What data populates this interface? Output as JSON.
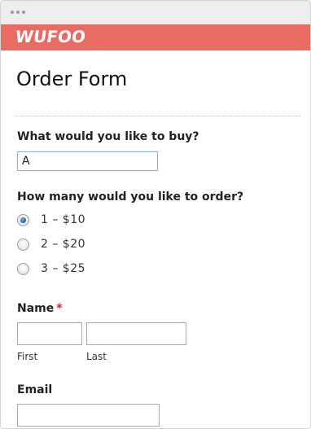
{
  "brand": {
    "logo_text": "WUFOO",
    "bar_color": "#e86c63"
  },
  "form": {
    "title": "Order Form",
    "product_field": {
      "label": "What would you like to buy?",
      "value": "A"
    },
    "quantity_field": {
      "label": "How many would you like to order?",
      "options": [
        {
          "label": "1 – $10",
          "checked": true
        },
        {
          "label": "2 – $20",
          "checked": false
        },
        {
          "label": "3 – $25",
          "checked": false
        }
      ]
    },
    "name_field": {
      "label": "Name",
      "required_marker": "*",
      "first_sublabel": "First",
      "last_sublabel": "Last",
      "first_value": "",
      "last_value": ""
    },
    "email_field": {
      "label": "Email",
      "value": ""
    }
  }
}
